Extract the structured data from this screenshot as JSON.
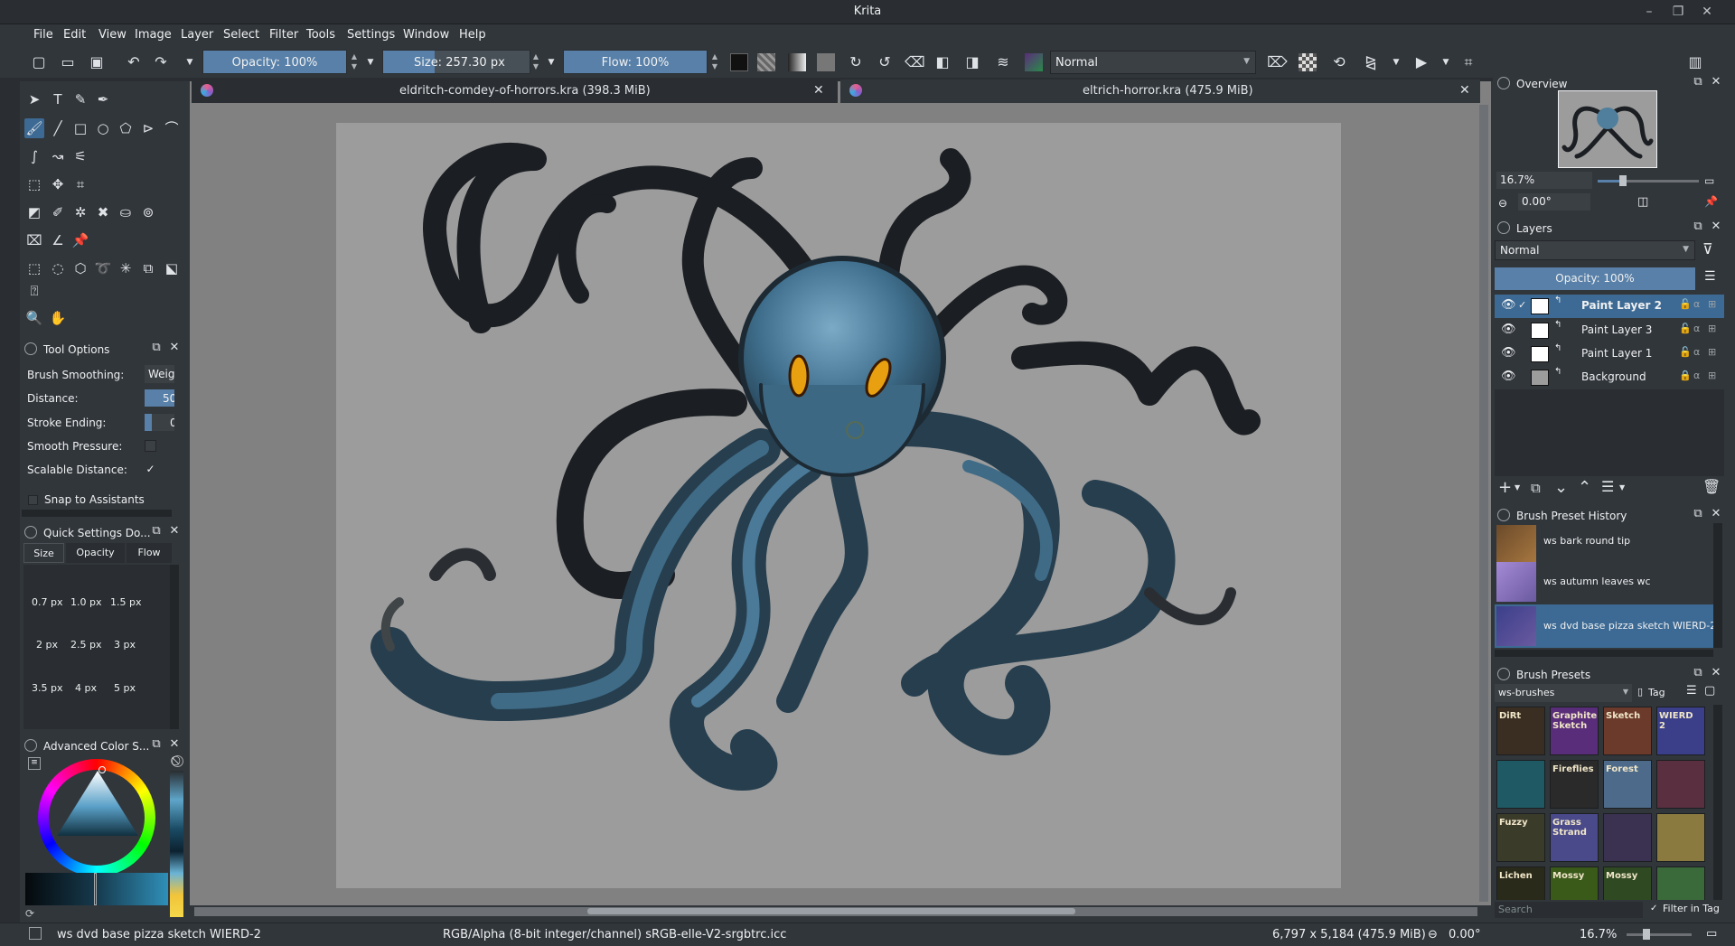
{
  "window": {
    "title": "Krita",
    "minimize": "–",
    "restore": "❐",
    "close": "✕"
  },
  "menubar": [
    "File",
    "Edit",
    "View",
    "Image",
    "Layer",
    "Select",
    "Filter",
    "Tools",
    "Settings",
    "Window",
    "Help"
  ],
  "toolbar": {
    "opacity": "Opacity: 100%",
    "size_label": "Size:",
    "size_value": "257.30 px",
    "flow": "Flow: 100%",
    "blend_mode": "Normal",
    "opacity_fill": 1.0,
    "size_fill": 0.35,
    "flow_fill": 1.0
  },
  "doc_tabs": [
    {
      "label": "eldritch-comdey-of-horrors.kra (398.3 MiB)"
    },
    {
      "label": "eltrich-horror.kra (475.9 MiB)"
    }
  ],
  "tool_options": {
    "title": "Tool Options",
    "brush_smoothing_label": "Brush Smoothing:",
    "brush_smoothing_value": "Weig",
    "distance_label": "Distance:",
    "distance_value": "50",
    "stroke_ending_label": "Stroke Ending:",
    "stroke_ending_value": "0.",
    "smooth_pressure_label": "Smooth Pressure:",
    "scalable_distance_label": "Scalable Distance:",
    "snap_label": "Snap to Assistants"
  },
  "quick_settings": {
    "title": "Quick Settings Do...",
    "tabs": [
      "Size",
      "Opacity",
      "Flow"
    ],
    "sizes": [
      "0.7 px",
      "1.0 px",
      "1.5 px",
      "2 px",
      "2.5 px",
      "3 px",
      "3.5 px",
      "4 px",
      "5 px"
    ]
  },
  "color_selector": {
    "title": "Advanced Color S..."
  },
  "overview": {
    "title": "Overview",
    "zoom": "16.7%",
    "rotation": "0.00°"
  },
  "layers": {
    "title": "Layers",
    "blend_mode": "Normal",
    "opacity": "Opacity:  100%",
    "items": [
      {
        "name": "Paint Layer 2",
        "selected": true
      },
      {
        "name": "Paint Layer 3",
        "selected": false
      },
      {
        "name": "Paint Layer 1",
        "selected": false
      },
      {
        "name": "Background",
        "selected": false
      }
    ]
  },
  "brush_history": {
    "title": "Brush Preset History",
    "items": [
      "ws bark round tip",
      "ws autumn leaves wc",
      "ws dvd base pizza sketch WIERD-2"
    ]
  },
  "brush_presets": {
    "title": "Brush Presets",
    "tag": "ws-brushes",
    "tag_button": "Tag",
    "search_placeholder": "Search",
    "filter_in_tag": "Filter in Tag",
    "tiles": [
      {
        "label": "DiRt",
        "color": "#3a2e22"
      },
      {
        "label": "Graphite Sketch",
        "color": "#5a2d7a"
      },
      {
        "label": "Sketch",
        "color": "#6b3a2a"
      },
      {
        "label": "WIERD 2",
        "color": "#3b3f8a"
      },
      {
        "label": "",
        "color": "#1f5a64"
      },
      {
        "label": "Fireflies",
        "color": "#2a2a2a"
      },
      {
        "label": "Forest",
        "color": "#4d6a8a"
      },
      {
        "label": "",
        "color": "#5a3040"
      },
      {
        "label": "Fuzzy",
        "color": "#3b3b2a"
      },
      {
        "label": "Grass Strand",
        "color": "#4a4a8a"
      },
      {
        "label": "",
        "color": "#3a3250"
      },
      {
        "label": "",
        "color": "#8a7a40"
      },
      {
        "label": "Lichen",
        "color": "#2a2a1a"
      },
      {
        "label": "Mossy",
        "color": "#3a5a1a"
      },
      {
        "label": "Mossy",
        "color": "#2f4a22"
      },
      {
        "label": "",
        "color": "#3a6a3a"
      }
    ]
  },
  "statusbar": {
    "brush": "ws dvd base pizza sketch WIERD-2",
    "color_space": "RGB/Alpha (8-bit integer/channel)  sRGB-elle-V2-srgbtrc.icc",
    "dimensions": "6,797 x 5,184 (475.9 MiB)",
    "rotation": "0.00°",
    "zoom": "16.7%"
  }
}
